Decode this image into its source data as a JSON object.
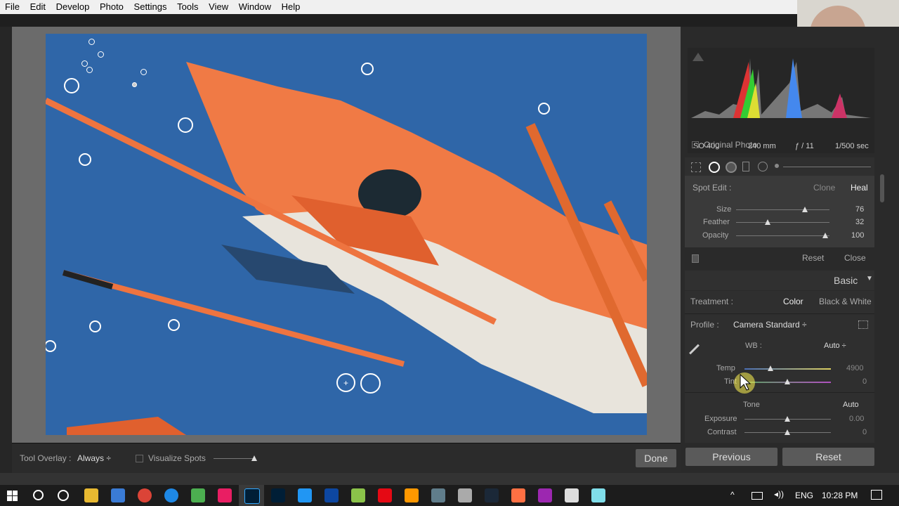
{
  "menu": [
    "File",
    "Edit",
    "Develop",
    "Photo",
    "Settings",
    "Tools",
    "View",
    "Window",
    "Help"
  ],
  "camera_info": {
    "iso": "ISO 400",
    "focal": "240 mm",
    "aperture": "ƒ / 11",
    "shutter": "1/500 sec"
  },
  "original_photo_label": "Original Photo",
  "spot_edit": {
    "title": "Spot Edit :",
    "clone": "Clone",
    "heal": "Heal",
    "size_label": "Size",
    "size_value": "76",
    "size_pct": 0.75,
    "feather_label": "Feather",
    "feather_value": "32",
    "feather_pct": 0.33,
    "opacity_label": "Opacity",
    "opacity_value": "100",
    "opacity_pct": 1.0,
    "reset": "Reset",
    "close": "Close"
  },
  "basic": {
    "title": "Basic",
    "treatment_label": "Treatment :",
    "color": "Color",
    "bw": "Black & White",
    "profile_label": "Profile :",
    "profile_value": "Camera Standard ÷",
    "wb_label": "WB :",
    "wb_value": "Auto ÷",
    "temp_label": "Temp",
    "temp_value": "4900",
    "tint_label": "Tint",
    "tint_value": "0",
    "tone_label": "Tone",
    "tone_auto": "Auto",
    "exposure_label": "Exposure",
    "exposure_value": "0.00",
    "contrast_label": "Contrast",
    "contrast_value": "0"
  },
  "buttons": {
    "previous": "Previous",
    "reset": "Reset",
    "done": "Done"
  },
  "toolbar": {
    "overlay_label": "Tool Overlay :",
    "overlay_value": "Always ÷",
    "visualize": "Visualize Spots"
  },
  "taskbar": {
    "lang": "ENG",
    "time": "10:28 PM"
  },
  "colors": {
    "accent": "#f07a45",
    "sky": "#2f66a8"
  }
}
